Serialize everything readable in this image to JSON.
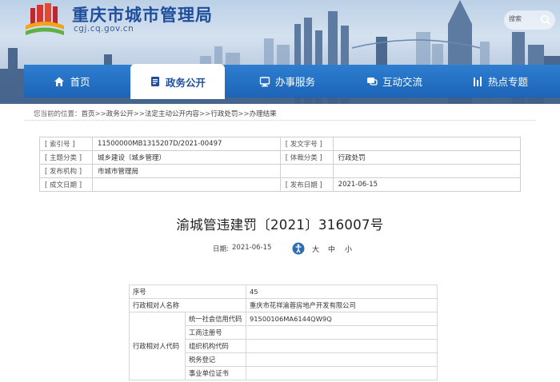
{
  "header": {
    "site_title": "重庆市城市管理局",
    "site_domain": "cgj.cq.gov.cn",
    "search_placeholder": "搜索"
  },
  "nav": {
    "items": [
      {
        "label": "首页",
        "icon": "home-icon"
      },
      {
        "label": "政务公开",
        "icon": "document-icon",
        "active": true
      },
      {
        "label": "办事服务",
        "icon": "service-icon"
      },
      {
        "label": "互动交流",
        "icon": "chat-icon"
      },
      {
        "label": "热点专题",
        "icon": "topic-icon"
      }
    ]
  },
  "breadcrumb": {
    "prefix": "您当前的位置：",
    "items": [
      "首页",
      "政务公开",
      "法定主动公开内容",
      "行政处罚",
      "办理结果"
    ],
    "separator": ">>"
  },
  "meta": {
    "index_label": "[ 索引号 ]",
    "index_value": "11500000MB1315207D/2021-00497",
    "doc_no_label": "[ 发文字号 ]",
    "doc_no_value": "",
    "topic_label": "[ 主题分类 ]",
    "topic_value": "城乡建设（城乡管理）",
    "genre_label": "[ 体裁分类 ]",
    "genre_value": "行政处罚",
    "issuer_label": "[ 发布机构 ]",
    "issuer_value": "市城市管理局",
    "created_label": "[ 成文日期 ]",
    "created_value": "",
    "published_label": "[ 发布日期 ]",
    "published_value": "2021-06-15"
  },
  "article": {
    "title": "渝城管违建罚〔2021〕316007号",
    "date_label": "日期:",
    "date_value": "2021-06-15",
    "font_large": "大",
    "font_medium": "中",
    "font_small": "小"
  },
  "detail": {
    "seq_label": "序号",
    "seq_value": "45",
    "party_label": "行政相对人名称",
    "party_value": "重庆市花祥渝蓉房地产开发有限公司",
    "code_label": "行政相对人代码",
    "credit_code_label": "统一社会信用代码",
    "credit_code_value": "91500106MA6144QW9Q",
    "biz_reg_label": "工商注册号",
    "biz_reg_value": "",
    "org_code_label": "组织机构代码",
    "org_code_value": "",
    "tax_reg_label": "税务登记",
    "tax_reg_value": "",
    "unit_cert_label": "事业单位证书",
    "unit_cert_value": ""
  },
  "colors": {
    "nav_blue": "#1c64b8",
    "title_blue": "#1f4f9c"
  }
}
